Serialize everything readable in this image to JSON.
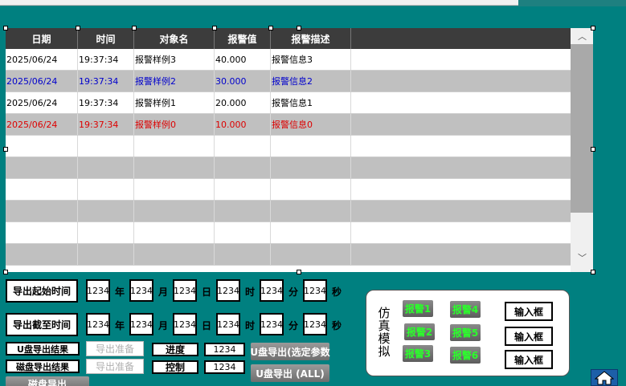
{
  "table": {
    "headers": [
      "日期",
      "时间",
      "对象名",
      "报警值",
      "报警描述"
    ],
    "rows": [
      {
        "date": "2025/06/24",
        "time": "19:37:34",
        "name": "报警样例3",
        "value": "40.000",
        "desc": "报警信息3",
        "color": "#000000"
      },
      {
        "date": "2025/06/24",
        "time": "19:37:34",
        "name": "报警样例2",
        "value": "30.000",
        "desc": "报警信息2",
        "color": "#0000cc"
      },
      {
        "date": "2025/06/24",
        "time": "19:37:34",
        "name": "报警样例1",
        "value": "20.000",
        "desc": "报警信息1",
        "color": "#000000"
      },
      {
        "date": "2025/06/24",
        "time": "19:37:34",
        "name": "报警样例0",
        "value": "10.000",
        "desc": "报警信息0",
        "color": "#dd0000"
      }
    ],
    "empty_rows": 6,
    "scroll_up": "︿",
    "scroll_down": "﹀"
  },
  "export": {
    "start_label": "导出起始时间",
    "end_label": "导出截至时间",
    "start_values": [
      "1234",
      "1234",
      "1234",
      "1234",
      "1234",
      "1234"
    ],
    "end_values": [
      "1234",
      "1234",
      "1234",
      "1234",
      "1234",
      "1234"
    ],
    "units": [
      "年",
      "月",
      "日",
      "时",
      "分",
      "秒"
    ],
    "usb_result": "U盘导出结果",
    "disk_result": "磁盘导出结果",
    "prep1": "导出准备",
    "prep2": "导出准备",
    "progress_label": "进度",
    "progress_value": "1234",
    "control_label": "控制",
    "control_value": "1234",
    "usb_export_selected": "U盘导出(选定参数",
    "usb_export_all": "U盘导出 (ALL)",
    "disk_export": "磁盘导出"
  },
  "sim": {
    "title": "仿真模拟",
    "alarms": [
      "报警1",
      "报警2",
      "报警3",
      "报警4",
      "报警5",
      "报警6"
    ],
    "inputs": [
      "输入框",
      "输入框",
      "输入框"
    ]
  },
  "home_icon": "home-icon"
}
